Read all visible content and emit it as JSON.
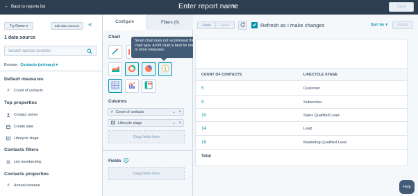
{
  "header": {
    "back_label": "Back to reports list",
    "report_name": "Enter report name",
    "save_label": "Save"
  },
  "sidebar": {
    "try_demo_label": "Try Demo",
    "edit_data_sources_label": "Edit data sources",
    "data_source_count": "1 data source",
    "search_placeholder": "Search across sources",
    "browse_label": "Browse:",
    "browse_value": "Contacts (primary)",
    "sections": [
      {
        "title": "Default measures",
        "items": [
          {
            "label": "Count of contacts",
            "icon": "hash-icon"
          }
        ]
      },
      {
        "title": "Top properties",
        "items": [
          {
            "label": "Contact owner",
            "icon": "owner-icon"
          },
          {
            "label": "Create date",
            "icon": "calendar-icon"
          },
          {
            "label": "Lifecycle stage",
            "icon": "dropdown-property-icon"
          }
        ]
      },
      {
        "title": "Contacts filters",
        "items": [
          {
            "label": "List membership",
            "icon": "list-icon"
          }
        ]
      },
      {
        "title": "Contacts properties",
        "items": [
          {
            "label": "Annual revenue",
            "icon": "hash-icon"
          }
        ]
      }
    ]
  },
  "config": {
    "tabs": [
      {
        "label": "Configure"
      },
      {
        "label": "Filters (0)"
      }
    ],
    "chart_heading": "Chart",
    "tooltip": "Smart chart does not recommend this chart type. A KPI chart is best for one or more measures.",
    "chart_types": [
      {
        "name": "smart-chart-icon",
        "selected": false
      },
      {
        "name": "bar-chart-icon",
        "selected": false
      },
      {
        "name": "area-chart-icon",
        "selected": false
      },
      {
        "name": "donut-chart-icon",
        "selected": true
      },
      {
        "name": "pie-chart-icon",
        "selected": true
      },
      {
        "name": "kpi-chart-icon",
        "selected": true
      },
      {
        "name": "table-chart-icon",
        "selected": true
      },
      {
        "name": "combo-chart-icon",
        "selected": false
      },
      {
        "name": "pivot-table-icon",
        "selected": false
      }
    ],
    "columns_heading": "Columns",
    "columns": [
      {
        "label": "Count of contacts",
        "icon": "hash-icon"
      },
      {
        "label": "Lifecycle stage",
        "icon": "dropdown-property-icon"
      }
    ],
    "drag_columns_label": "Drag fields here",
    "fields_heading": "Fields",
    "drag_fields_label": "Drag fields here"
  },
  "toolbar": {
    "undo_label": "Undo",
    "redo_label": "Redo",
    "refresh_label": "Refresh as I make changes",
    "refresh_checked": true,
    "sort_label": "Sort by",
    "export_label": "Export"
  },
  "table": {
    "headers": [
      "COUNT OF CONTACTS",
      "LIFECYCLE STAGE"
    ],
    "rows": [
      {
        "count": "5",
        "stage": "Customer"
      },
      {
        "count": "9",
        "stage": "Subscriber"
      },
      {
        "count": "10",
        "stage": "Sales Qualified Lead"
      },
      {
        "count": "14",
        "stage": "Lead"
      },
      {
        "count": "19",
        "stage": "Marketing Qualified Lead"
      }
    ],
    "total_label": "Total"
  },
  "help_label": "Help",
  "colors": {
    "header_bg": "#2d3e50",
    "accent": "#0091ae",
    "text": "#33475b",
    "tooltip_bg": "#425b76",
    "chart_orange": "#ff7a59",
    "chart_teal": "#00bda5"
  }
}
